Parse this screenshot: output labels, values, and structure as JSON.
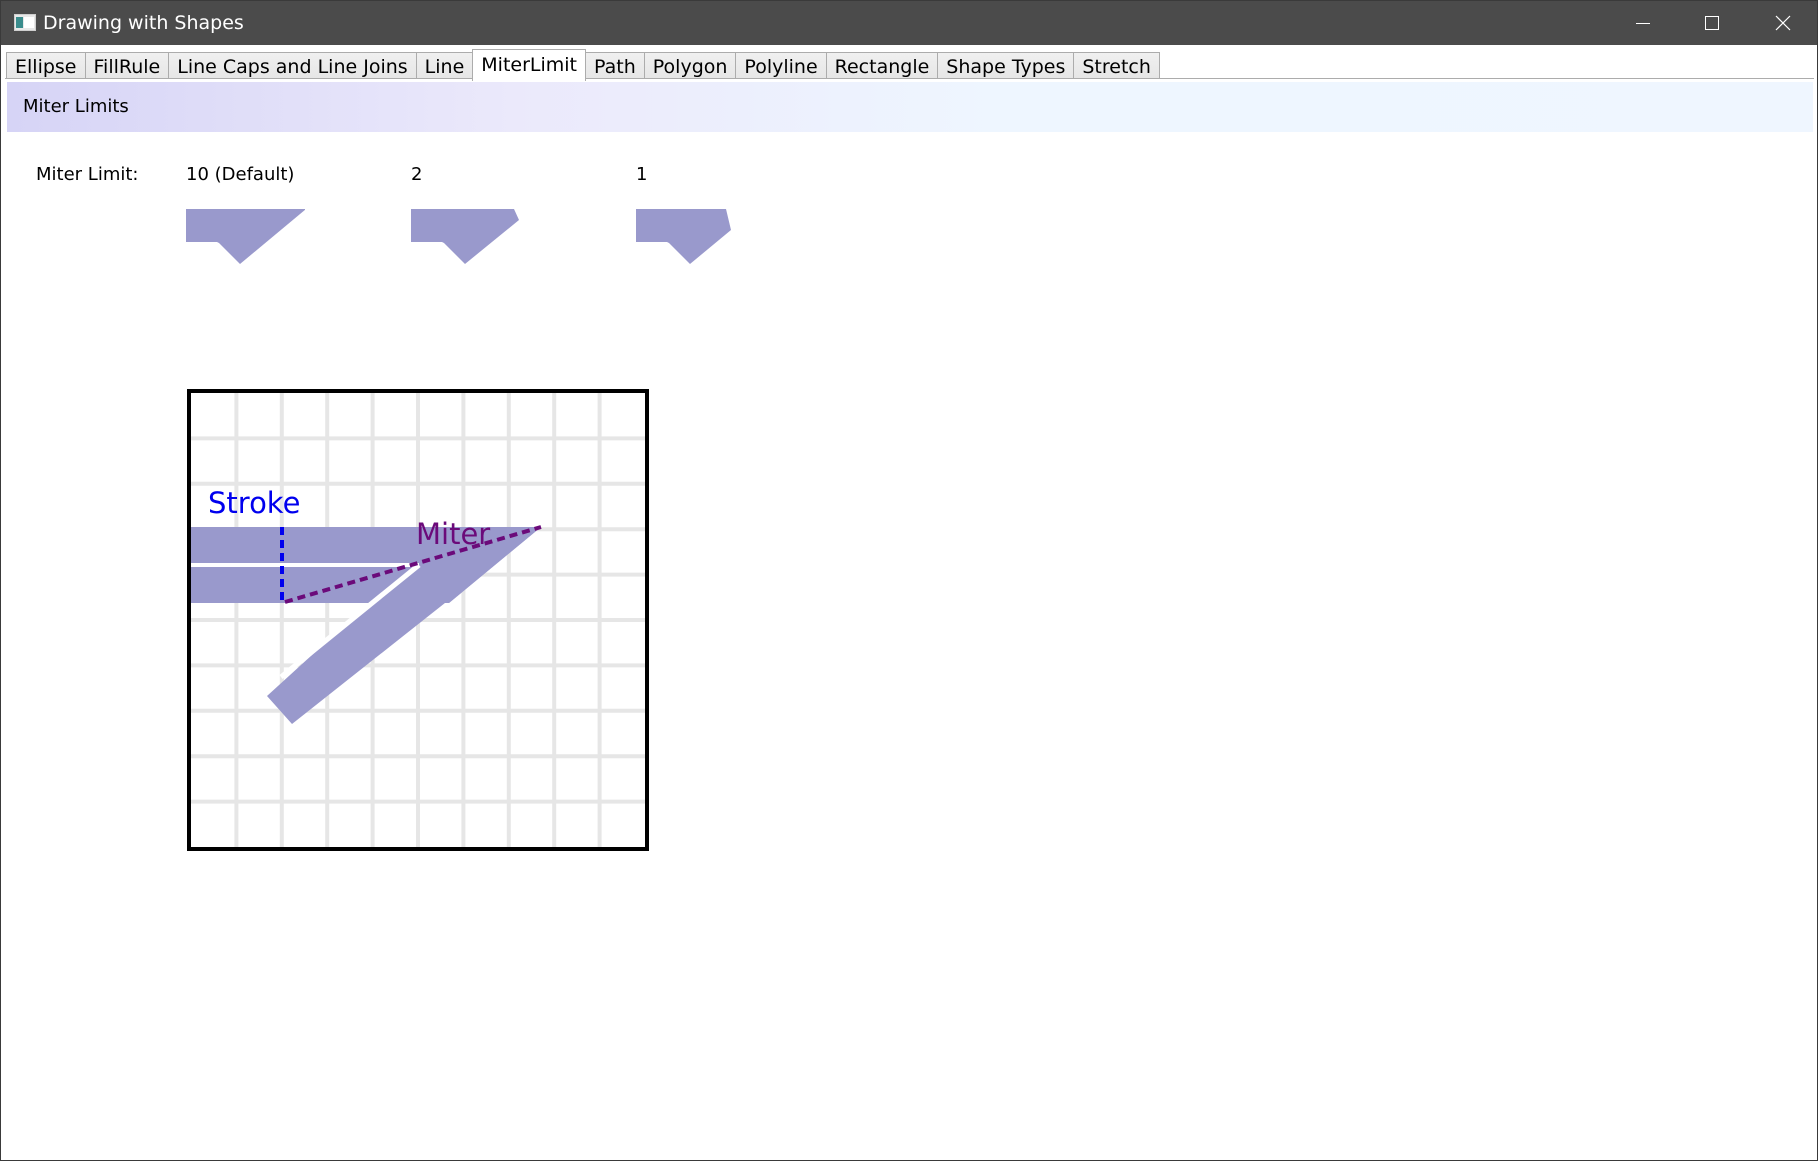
{
  "window": {
    "title": "Drawing with Shapes",
    "icons": {
      "app": "app-window-icon",
      "minimize": "minimize-icon",
      "maximize": "maximize-icon",
      "close": "close-icon"
    }
  },
  "tabs": [
    {
      "label": "Ellipse",
      "selected": false
    },
    {
      "label": "FillRule",
      "selected": false
    },
    {
      "label": "Line Caps and Line Joins",
      "selected": false
    },
    {
      "label": "Line",
      "selected": false
    },
    {
      "label": "MiterLimit",
      "selected": true
    },
    {
      "label": "Path",
      "selected": false
    },
    {
      "label": "Polygon",
      "selected": false
    },
    {
      "label": "Polyline",
      "selected": false
    },
    {
      "label": "Rectangle",
      "selected": false
    },
    {
      "label": "Shape Types",
      "selected": false
    },
    {
      "label": "Stretch",
      "selected": false
    }
  ],
  "page": {
    "header": "Miter Limits",
    "miter_limit_label": "Miter Limit:",
    "samples": [
      {
        "label": "10 (Default)",
        "miter_limit": 10
      },
      {
        "label": "2",
        "miter_limit": 2
      },
      {
        "label": "1",
        "miter_limit": 1
      }
    ]
  },
  "diagram": {
    "stroke_label": "Stroke",
    "miter_label": "Miter",
    "grid_cells": 10
  },
  "colors": {
    "shape_fill": "#9999cc",
    "stroke_annotation": "#0000ee",
    "miter_annotation": "#6b0a7a",
    "grid_line": "#e6e6e6",
    "titlebar": "#4b4b4b"
  }
}
